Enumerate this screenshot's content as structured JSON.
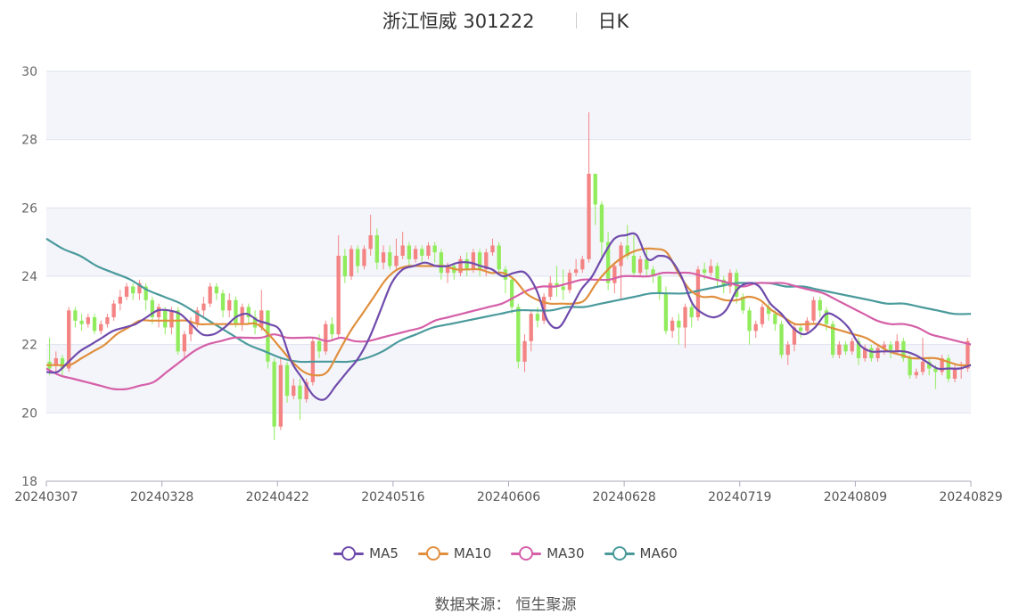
{
  "title": {
    "stock": "浙江恒威 301222",
    "period": "日K"
  },
  "source": {
    "label": "数据来源：",
    "name": "恒生聚源"
  },
  "colors": {
    "up": "#f48484",
    "down": "#90ec5c",
    "ma5": "#6f4bab",
    "ma10": "#e08f3d",
    "ma30": "#d55fa8",
    "ma60": "#4a9a9c",
    "band": "#f4f5fa",
    "grid": "#dfe3ef"
  },
  "chart_data": {
    "type": "candlestick",
    "ylim": [
      18,
      30
    ],
    "yticks": [
      18,
      20,
      22,
      24,
      26,
      28,
      30
    ],
    "xtick_labels": [
      "20240307",
      "20240328",
      "20240422",
      "20240516",
      "20240606",
      "20240628",
      "20240719",
      "20240809",
      "20240829"
    ],
    "ma_legend": [
      "MA5",
      "MA10",
      "MA30",
      "MA60"
    ],
    "candles": [
      [
        21.5,
        21.3,
        22.2,
        21.1
      ],
      [
        21.4,
        21.6,
        21.8,
        21.2
      ],
      [
        21.6,
        21.3,
        21.7,
        21.1
      ],
      [
        21.3,
        23.0,
        23.1,
        21.2
      ],
      [
        23.0,
        22.7,
        23.1,
        22.5
      ],
      [
        22.7,
        22.6,
        22.9,
        22.4
      ],
      [
        22.6,
        22.8,
        22.9,
        22.5
      ],
      [
        22.8,
        22.4,
        22.9,
        22.3
      ],
      [
        22.4,
        22.6,
        22.7,
        22.3
      ],
      [
        22.6,
        22.8,
        22.9,
        22.5
      ],
      [
        22.8,
        23.2,
        23.3,
        22.7
      ],
      [
        23.2,
        23.4,
        23.6,
        23.0
      ],
      [
        23.4,
        23.7,
        23.8,
        23.3
      ],
      [
        23.7,
        23.5,
        23.8,
        23.3
      ],
      [
        23.5,
        23.8,
        23.9,
        23.3
      ],
      [
        23.7,
        23.3,
        23.8,
        23.0
      ],
      [
        23.3,
        22.8,
        23.4,
        22.6
      ],
      [
        22.8,
        23.1,
        23.2,
        22.5
      ],
      [
        23.0,
        22.5,
        23.1,
        22.3
      ],
      [
        22.5,
        23.0,
        23.1,
        22.3
      ],
      [
        23.0,
        21.8,
        23.1,
        21.7
      ],
      [
        21.8,
        22.3,
        22.4,
        21.6
      ],
      [
        22.3,
        22.6,
        22.8,
        22.1
      ],
      [
        22.6,
        23.0,
        23.1,
        22.5
      ],
      [
        23.0,
        23.2,
        23.4,
        22.8
      ],
      [
        23.2,
        23.7,
        23.8,
        23.1
      ],
      [
        23.7,
        23.5,
        23.8,
        23.3
      ],
      [
        23.5,
        23.0,
        23.6,
        22.8
      ],
      [
        23.0,
        23.3,
        23.5,
        22.8
      ],
      [
        23.3,
        22.6,
        23.4,
        22.5
      ],
      [
        22.6,
        23.1,
        23.2,
        22.4
      ],
      [
        23.1,
        22.8,
        23.2,
        22.6
      ],
      [
        22.8,
        22.5,
        23.0,
        22.3
      ],
      [
        22.5,
        23.0,
        23.6,
        22.4
      ],
      [
        23.0,
        21.5,
        23.0,
        21.3
      ],
      [
        21.5,
        19.6,
        21.6,
        19.2
      ],
      [
        19.6,
        21.4,
        21.6,
        19.5
      ],
      [
        21.4,
        20.5,
        21.5,
        20.3
      ],
      [
        20.5,
        20.8,
        21.0,
        20.4
      ],
      [
        20.8,
        20.4,
        21.0,
        19.8
      ],
      [
        20.4,
        20.9,
        21.0,
        20.3
      ],
      [
        20.9,
        22.1,
        22.2,
        20.8
      ],
      [
        22.1,
        21.8,
        22.3,
        21.6
      ],
      [
        21.8,
        22.6,
        22.7,
        21.7
      ],
      [
        22.6,
        22.3,
        22.8,
        22.1
      ],
      [
        22.3,
        24.6,
        25.2,
        22.2
      ],
      [
        24.6,
        24.0,
        24.8,
        23.8
      ],
      [
        24.0,
        24.8,
        24.9,
        23.9
      ],
      [
        24.8,
        24.3,
        24.9,
        24.1
      ],
      [
        24.3,
        24.8,
        24.9,
        24.2
      ],
      [
        24.8,
        25.2,
        25.8,
        24.6
      ],
      [
        25.2,
        24.4,
        25.4,
        24.2
      ],
      [
        24.4,
        24.7,
        24.9,
        24.2
      ],
      [
        24.7,
        24.3,
        24.9,
        24.2
      ],
      [
        24.3,
        24.6,
        25.1,
        24.2
      ],
      [
        24.6,
        24.9,
        25.3,
        24.5
      ],
      [
        24.9,
        24.5,
        25.0,
        24.3
      ],
      [
        24.5,
        24.8,
        24.9,
        24.4
      ],
      [
        24.8,
        24.6,
        24.9,
        24.4
      ],
      [
        24.6,
        24.9,
        25.0,
        24.5
      ],
      [
        24.9,
        24.7,
        25.0,
        24.4
      ],
      [
        24.7,
        24.1,
        24.8,
        23.9
      ],
      [
        24.1,
        24.3,
        24.4,
        23.8
      ],
      [
        24.3,
        24.1,
        24.4,
        23.9
      ],
      [
        24.1,
        24.5,
        24.6,
        24.0
      ],
      [
        24.5,
        24.2,
        24.7,
        24.0
      ],
      [
        24.2,
        24.7,
        24.8,
        24.1
      ],
      [
        24.7,
        24.2,
        24.8,
        24.0
      ],
      [
        24.2,
        24.7,
        24.8,
        24.0
      ],
      [
        24.7,
        24.9,
        25.1,
        24.6
      ],
      [
        24.9,
        24.2,
        25.0,
        24.1
      ],
      [
        24.2,
        23.9,
        24.3,
        23.5
      ],
      [
        23.9,
        23.1,
        24.0,
        22.9
      ],
      [
        23.1,
        21.5,
        23.2,
        21.3
      ],
      [
        21.5,
        22.1,
        22.3,
        21.2
      ],
      [
        22.1,
        22.9,
        23.0,
        21.8
      ],
      [
        22.9,
        22.7,
        23.1,
        22.5
      ],
      [
        22.7,
        23.4,
        23.5,
        22.6
      ],
      [
        23.4,
        23.8,
        24.0,
        23.3
      ],
      [
        23.8,
        23.7,
        24.3,
        23.4
      ],
      [
        23.7,
        23.6,
        24.2,
        23.3
      ],
      [
        23.6,
        24.1,
        24.2,
        23.5
      ],
      [
        24.1,
        24.2,
        24.5,
        24.0
      ],
      [
        24.2,
        24.5,
        24.6,
        24.1
      ],
      [
        24.5,
        27.0,
        28.8,
        24.4
      ],
      [
        27.0,
        26.1,
        26.4,
        25.5
      ],
      [
        26.1,
        25.0,
        26.2,
        24.5
      ],
      [
        25.0,
        23.8,
        25.3,
        23.6
      ],
      [
        23.8,
        24.3,
        24.4,
        23.5
      ],
      [
        24.3,
        24.9,
        25.0,
        23.3
      ],
      [
        24.9,
        24.6,
        25.5,
        24.5
      ],
      [
        24.6,
        24.1,
        25.2,
        24.0
      ],
      [
        24.1,
        24.5,
        24.6,
        24.0
      ],
      [
        24.5,
        24.2,
        24.8,
        24.0
      ],
      [
        24.2,
        24.0,
        24.3,
        23.8
      ],
      [
        24.0,
        23.5,
        24.1,
        23.3
      ],
      [
        23.5,
        22.4,
        23.7,
        22.3
      ],
      [
        22.4,
        22.7,
        22.8,
        22.2
      ],
      [
        22.7,
        22.5,
        22.9,
        22.0
      ],
      [
        22.5,
        23.1,
        23.2,
        21.9
      ],
      [
        23.1,
        22.8,
        23.2,
        22.5
      ],
      [
        22.8,
        24.2,
        24.3,
        22.7
      ],
      [
        24.2,
        24.1,
        24.4,
        23.9
      ],
      [
        24.1,
        24.3,
        24.5,
        24.0
      ],
      [
        24.3,
        23.9,
        24.4,
        23.7
      ],
      [
        23.9,
        23.7,
        24.0,
        23.5
      ],
      [
        23.7,
        24.1,
        24.2,
        23.5
      ],
      [
        24.1,
        23.4,
        24.2,
        23.2
      ],
      [
        23.4,
        23.0,
        23.5,
        22.9
      ],
      [
        23.0,
        22.4,
        23.1,
        22.0
      ],
      [
        22.4,
        22.6,
        22.7,
        22.2
      ],
      [
        22.6,
        23.1,
        23.2,
        22.5
      ],
      [
        23.1,
        22.9,
        23.2,
        22.7
      ],
      [
        22.9,
        22.6,
        23.0,
        22.4
      ],
      [
        22.6,
        21.7,
        22.7,
        21.6
      ],
      [
        21.7,
        22.0,
        22.1,
        21.4
      ],
      [
        22.0,
        22.5,
        22.6,
        21.8
      ],
      [
        22.5,
        22.4,
        22.6,
        22.2
      ],
      [
        22.4,
        22.7,
        22.8,
        22.3
      ],
      [
        22.7,
        23.3,
        23.4,
        22.6
      ],
      [
        23.3,
        23.0,
        23.4,
        22.8
      ],
      [
        23.0,
        22.6,
        23.1,
        22.4
      ],
      [
        22.6,
        21.7,
        22.7,
        21.6
      ],
      [
        21.7,
        22.0,
        22.1,
        21.6
      ],
      [
        22.0,
        21.8,
        22.1,
        21.7
      ],
      [
        21.8,
        22.1,
        22.2,
        21.7
      ],
      [
        22.1,
        21.6,
        22.2,
        21.4
      ],
      [
        21.6,
        21.9,
        22.0,
        21.5
      ],
      [
        21.9,
        21.6,
        22.0,
        21.5
      ],
      [
        21.6,
        21.9,
        22.0,
        21.5
      ],
      [
        21.9,
        22.0,
        22.1,
        21.7
      ],
      [
        22.0,
        21.8,
        22.1,
        21.6
      ],
      [
        21.8,
        22.1,
        22.3,
        21.7
      ],
      [
        22.1,
        21.6,
        22.2,
        21.5
      ],
      [
        21.6,
        21.1,
        21.7,
        21.0
      ],
      [
        21.1,
        21.2,
        21.3,
        21.0
      ],
      [
        21.2,
        21.5,
        22.2,
        21.1
      ],
      [
        21.5,
        21.3,
        21.6,
        21.1
      ],
      [
        21.3,
        21.2,
        21.4,
        20.7
      ],
      [
        21.2,
        21.6,
        21.7,
        21.1
      ],
      [
        21.6,
        21.0,
        21.7,
        20.9
      ],
      [
        21.0,
        21.3,
        21.4,
        20.9
      ],
      [
        21.3,
        21.3,
        21.5,
        21.0
      ],
      [
        21.3,
        22.1,
        22.2,
        21.2
      ]
    ],
    "ma5": [
      21.2,
      21.2,
      21.5,
      21.8,
      22.0,
      22.2,
      22.4,
      22.5,
      22.6,
      22.8,
      23.0,
      23.0,
      22.9,
      22.6,
      22.3,
      22.3,
      22.5,
      22.8,
      22.9,
      22.7,
      22.6,
      22.4,
      21.5,
      21.0,
      20.5,
      20.4,
      20.8,
      21.2,
      21.6,
      22.2,
      23.0,
      23.8,
      24.2,
      24.3,
      24.4,
      24.3,
      24.3,
      24.4,
      24.4,
      24.3,
      24.2,
      24.0,
      24.1,
      24.1,
      23.6,
      22.7,
      22.5,
      23.0,
      23.6,
      24.0,
      24.6,
      25.1,
      25.2,
      25.2,
      24.5,
      24.6,
      24.5,
      24.0,
      23.2,
      22.9,
      22.8,
      23.0,
      23.6,
      23.8,
      23.7,
      23.2,
      22.9,
      22.5,
      22.3,
      22.5,
      22.9,
      22.8,
      22.5,
      22.0,
      21.8,
      21.8,
      21.8,
      21.8,
      21.7,
      21.5,
      21.3,
      21.3,
      21.3,
      21.4
    ],
    "ma10": [
      21.4,
      21.4,
      21.4,
      21.6,
      21.8,
      22.0,
      22.3,
      22.5,
      22.7,
      22.7,
      22.7,
      22.7,
      22.7,
      22.6,
      22.6,
      22.6,
      22.6,
      22.6,
      22.6,
      22.3,
      21.9,
      21.5,
      21.2,
      21.1,
      21.2,
      21.8,
      22.4,
      22.9,
      23.4,
      23.9,
      24.2,
      24.3,
      24.3,
      24.3,
      24.3,
      24.2,
      24.2,
      24.2,
      24.1,
      24.1,
      23.9,
      23.5,
      23.3,
      23.2,
      23.2,
      23.2,
      23.3,
      23.8,
      24.2,
      24.5,
      24.7,
      24.8,
      24.8,
      24.7,
      24.1,
      23.6,
      23.4,
      23.4,
      23.3,
      23.3,
      23.4,
      23.3,
      23.0,
      22.8,
      22.6,
      22.6,
      22.6,
      22.5,
      22.4,
      22.3,
      22.2,
      22.0,
      21.8,
      21.7,
      21.6,
      21.6,
      21.6,
      21.5,
      21.4,
      21.4
    ],
    "ma30": [
      21.3,
      21.1,
      21.0,
      20.9,
      20.8,
      20.7,
      20.7,
      20.8,
      20.9,
      21.2,
      21.5,
      21.8,
      22.0,
      22.1,
      22.2,
      22.2,
      22.2,
      22.3,
      22.2,
      22.2,
      22.2,
      22.1,
      22.2,
      22.1,
      22.1,
      22.2,
      22.3,
      22.4,
      22.5,
      22.7,
      22.8,
      22.9,
      23.0,
      23.1,
      23.2,
      23.4,
      23.6,
      23.7,
      23.7,
      23.8,
      23.9,
      23.9,
      23.9,
      24.0,
      24.0,
      24.0,
      24.1,
      24.1,
      24.1,
      24.0,
      23.9,
      23.8,
      23.7,
      23.8,
      23.8,
      23.8,
      23.7,
      23.6,
      23.5,
      23.3,
      23.1,
      22.9,
      22.7,
      22.6,
      22.6,
      22.5,
      22.3,
      22.2,
      22.1,
      22.0
    ],
    "ma60": [
      25.1,
      24.8,
      24.6,
      24.3,
      24.1,
      23.9,
      23.6,
      23.4,
      23.2,
      22.9,
      22.6,
      22.3,
      22.0,
      21.8,
      21.6,
      21.5,
      21.5,
      21.5,
      21.5,
      21.6,
      21.8,
      22.1,
      22.3,
      22.5,
      22.6,
      22.7,
      22.8,
      22.9,
      23.0,
      23.0,
      23.0,
      23.1,
      23.1,
      23.2,
      23.3,
      23.4,
      23.5,
      23.5,
      23.5,
      23.6,
      23.7,
      23.8,
      23.8,
      23.8,
      23.7,
      23.7,
      23.6,
      23.5,
      23.4,
      23.3,
      23.2,
      23.2,
      23.1,
      23.0,
      22.9,
      22.9
    ]
  }
}
